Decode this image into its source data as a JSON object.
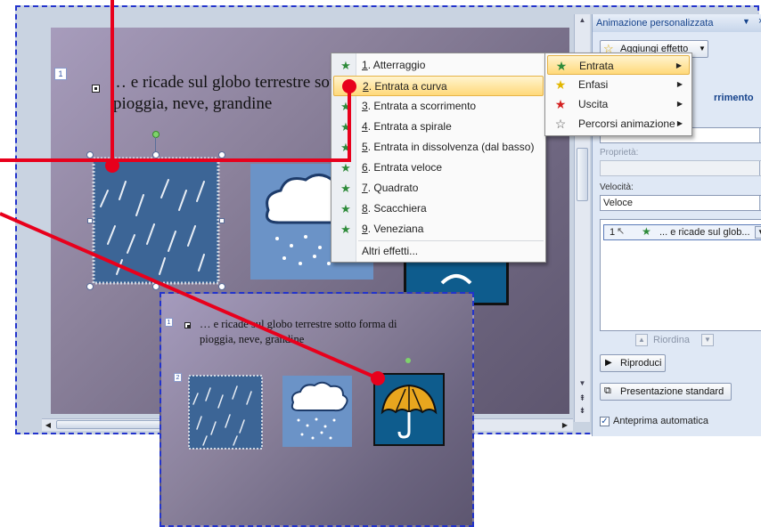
{
  "slide": {
    "number1": "1",
    "text_line1": "… e ricade sul globo terrestre sotto forma di",
    "text_line2": "pioggia, neve, grandine"
  },
  "context_menu": {
    "items": [
      {
        "key": "1",
        "label": ". Atterraggio"
      },
      {
        "key": "2",
        "label": ". Entrata a curva"
      },
      {
        "key": "3",
        "label": ". Entrata a scorrimento"
      },
      {
        "key": "4",
        "label": ". Entrata a spirale"
      },
      {
        "key": "5",
        "label": ". Entrata in dissolvenza (dal basso)"
      },
      {
        "key": "6",
        "label": ". Entrata veloce"
      },
      {
        "key": "7",
        "label": ". Quadrato"
      },
      {
        "key": "8",
        "label": ". Scacchiera"
      },
      {
        "key": "9",
        "label": ". Veneziana"
      }
    ],
    "more": "Altri effetti...",
    "highlighted_index": 1
  },
  "submenu": {
    "items": [
      {
        "label": "Entrata",
        "icon": "entrance-star-icon",
        "color": "#2e8b3a"
      },
      {
        "label": "Enfasi",
        "icon": "emphasis-star-icon",
        "color": "#e2b700"
      },
      {
        "label": "Uscita",
        "icon": "exit-star-icon",
        "color": "#d42020"
      },
      {
        "label": "Percorsi animazione",
        "icon": "motion-path-star-icon",
        "color": "#555555"
      }
    ]
  },
  "panel": {
    "title": "Animazione personalizzata",
    "add_effect": "Aggiungi effetto",
    "partial_header": "rrimento",
    "properties_label": "Proprietà:",
    "speed_label": "Velocità:",
    "speed_value": "Veloce",
    "list_item_number": "1",
    "list_item_text": "... e ricade sul glob...",
    "reorder_label": "Riordina",
    "play": "Riproduci",
    "slideshow": "Presentazione standard",
    "autopreview": "Anteprima automatica"
  },
  "thumbnail": {
    "number1": "1",
    "number2": "2",
    "text_line1": "… e ricade sul globo terrestre sotto forma di",
    "text_line2": "pioggia, neve, grandine"
  },
  "colors": {
    "annotation_red": "#e8001c",
    "dashed_border": "#2233cc",
    "menu_highlight": "#ffd97a"
  }
}
